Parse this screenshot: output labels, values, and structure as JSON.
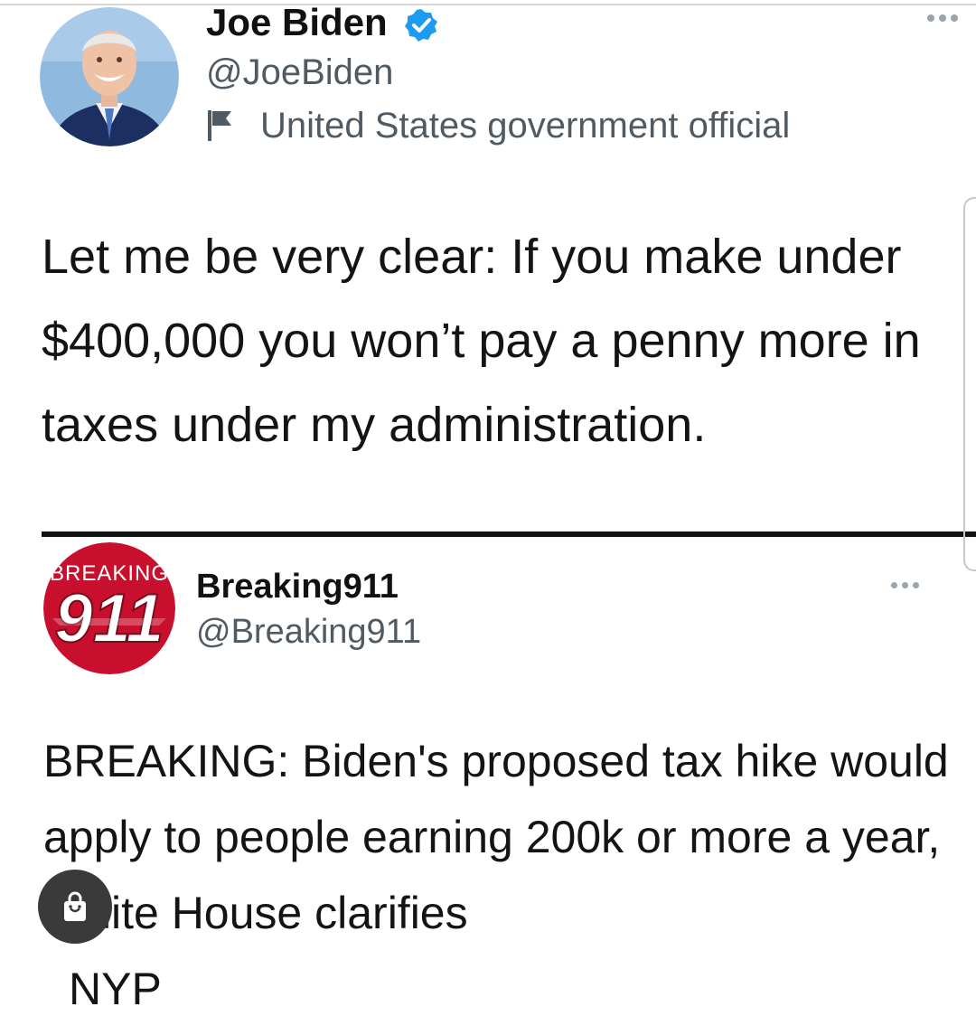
{
  "tweets": [
    {
      "name": "Joe Biden",
      "handle": "@JoeBiden",
      "label": "United States government official",
      "text": "Let me be very clear: If you make under $400,000 you won’t pay a penny more in taxes under my administration."
    },
    {
      "name": "Breaking911",
      "handle": "@Breaking911",
      "avatar_text": {
        "top": "BREAKING",
        "main": "911"
      },
      "text": "BREAKING: Biden's proposed tax hike would apply to people earning 200k or more a year, White House clarifies",
      "cut_off_text": "NYP"
    }
  ],
  "icons": {
    "verified": "verified-badge-icon",
    "label": "flag-icon",
    "more": "more-options-icon",
    "overlay": "shopping-bag-icon"
  },
  "colors": {
    "verified_blue": "#1d9bf0",
    "breaking_red": "#c8102e",
    "handle_gray": "#505a63"
  }
}
